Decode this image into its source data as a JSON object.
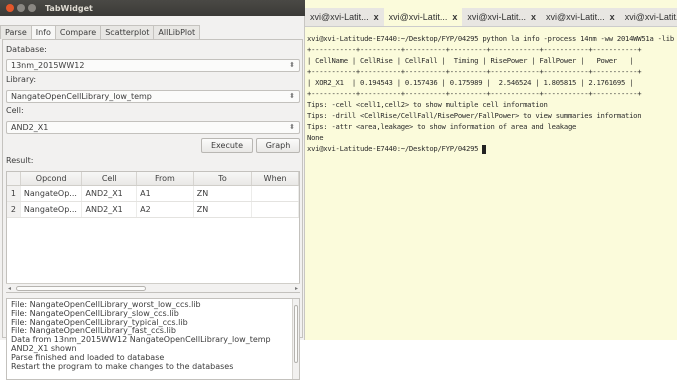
{
  "window": {
    "title": "TabWidget"
  },
  "tabs": [
    "Parse",
    "Info",
    "Compare",
    "Scatterplot",
    "AllLibPlot"
  ],
  "active_tab": "Info",
  "form": {
    "database_label": "Database:",
    "database_value": "13nm_2015WW12",
    "library_label": "Library:",
    "library_value": "NangateOpenCellLibrary_low_temp",
    "cell_label": "Cell:",
    "cell_value": "AND2_X1",
    "execute_label": "Execute",
    "graph_label": "Graph",
    "result_label": "Result:"
  },
  "result_table": {
    "columns": [
      "",
      "Opcond",
      "Cell",
      "From",
      "To",
      "When"
    ],
    "rows": [
      [
        "1",
        "NangateOp...",
        "AND2_X1",
        "A1",
        "ZN",
        ""
      ],
      [
        "2",
        "NangateOp...",
        "AND2_X1",
        "A2",
        "ZN",
        ""
      ]
    ]
  },
  "log_lines": [
    "File: NangateOpenCellLibrary_worst_low_ccs.lib",
    "File: NangateOpenCellLibrary_slow_ccs.lib",
    "File: NangateOpenCellLibrary_typical_ccs.lib",
    "File: NangateOpenCellLibrary_fast_ccs.lib",
    "Data from 13nm_2015WW12 NangateOpenCellLibrary_low_temp",
    "AND2_X1 shown",
    "Parse finished and loaded to database",
    "Restart the program to make changes to the databases"
  ],
  "terminal": {
    "tabs": [
      "xvi@xvi-Latit...",
      "xvi@xvi-Latit...",
      "xvi@xvi-Latit...",
      "xvi@xvi-Latit...",
      "xvi@xvi-Latit..."
    ],
    "active_tab_index": 1,
    "lines": [
      "xvi@xvi-Latitude-E7440:~/Desktop/FYP/04295 python lа info -process 14nm -ww 2014WW51a -lib NangateOpenCellLibrary_",
      "+-----------+----------+----------+---------+------------+-----------+-----------+",
      "| CellName | CellRise | CellFall |  Timing | RisePower | FallPower |   Power   |",
      "+-----------+----------+----------+---------+------------+-----------+-----------+",
      "| XOR2_X1  | 0.194543 | 0.157436 | 0.175989 |  2.546524 | 1.805815 | 2.1761695 |",
      "+-----------+----------+----------+---------+------------+-----------+-----------+",
      "Tips: -cell <cell1,cell2> to show multiple cell information",
      "Tips: -drill <CellRise/CellFall/RisePower/FallPower> to view summaries information",
      "Tips: -attr <area,leakage> to show information of area and leakage",
      "",
      "None",
      "xvi@xvi-Latitude-E7440:~/Desktop/FYP/04295 "
    ]
  }
}
